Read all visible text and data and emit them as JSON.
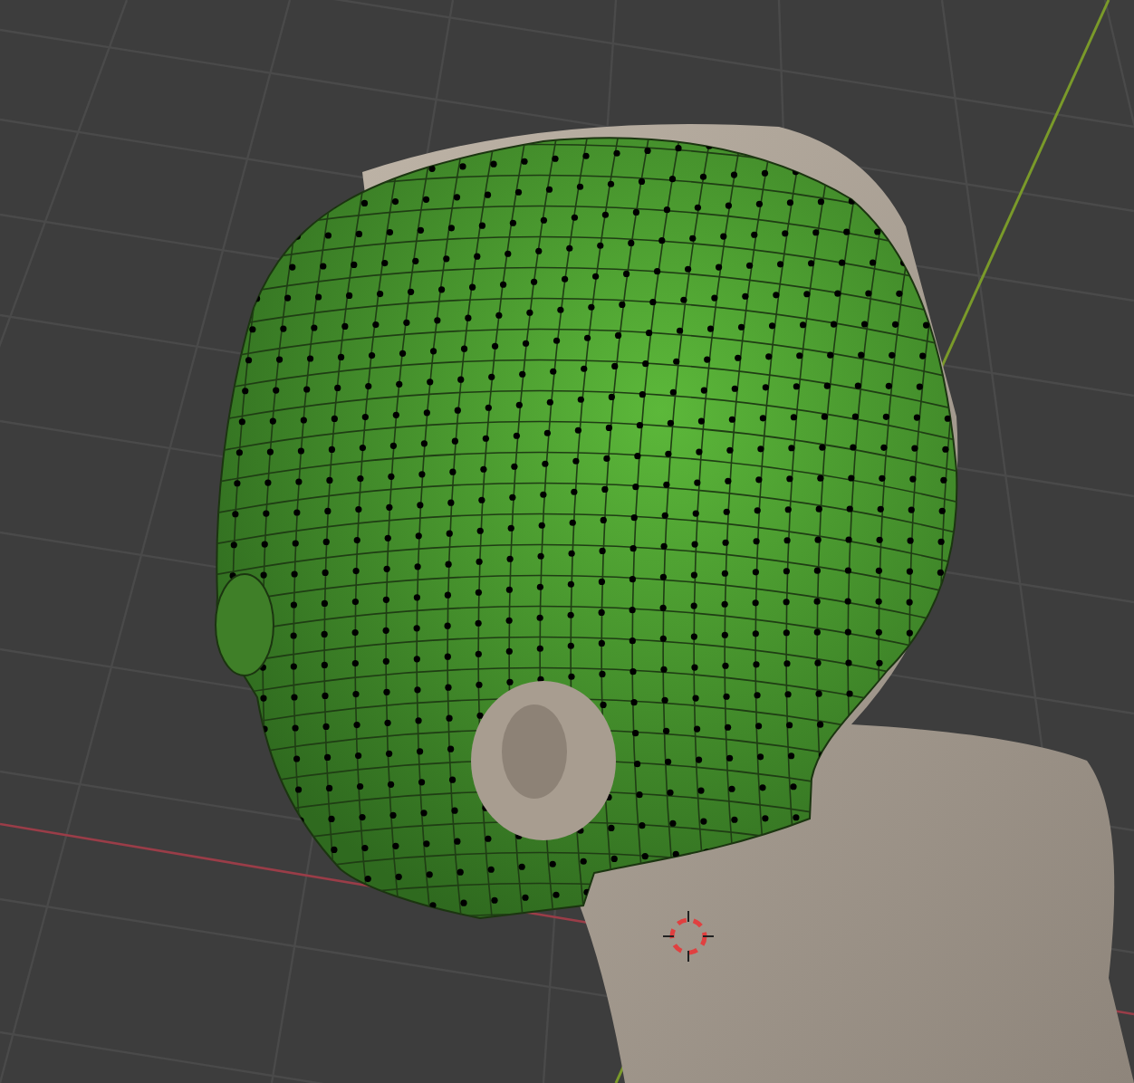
{
  "viewport": {
    "items": [
      {
        "kind": "grid"
      },
      {
        "kind": "axis-x"
      },
      {
        "kind": "axis-y"
      },
      {
        "kind": "bust"
      },
      {
        "kind": "mesh"
      },
      {
        "kind": "cursor"
      }
    ]
  }
}
